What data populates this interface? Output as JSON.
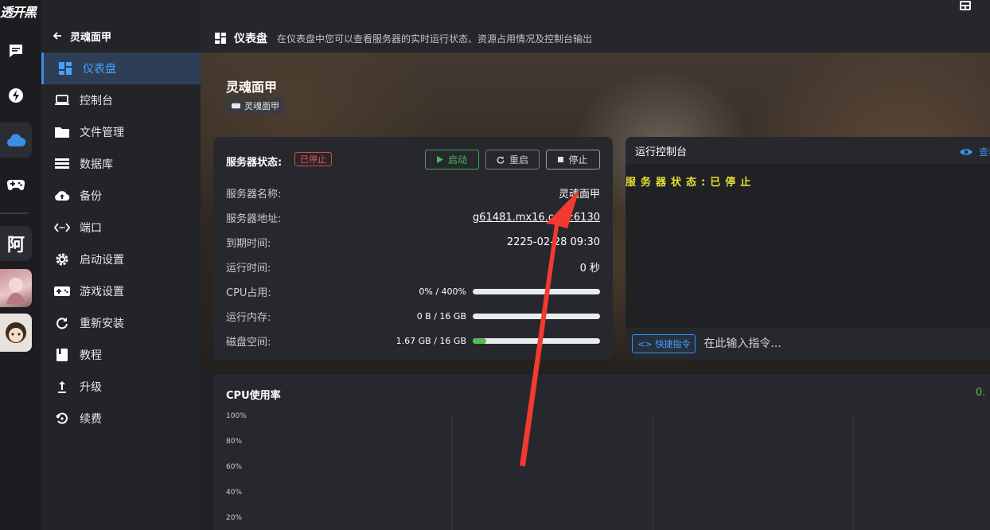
{
  "rail": {
    "logo_text": "透开黑",
    "avatar_letter": "阿"
  },
  "sidebar": {
    "back_label": "灵魂面甲",
    "items": [
      {
        "label": "仪表盘",
        "icon": "dashboard-icon"
      },
      {
        "label": "控制台",
        "icon": "console-icon"
      },
      {
        "label": "文件管理",
        "icon": "folder-icon"
      },
      {
        "label": "数据库",
        "icon": "database-icon"
      },
      {
        "label": "备份",
        "icon": "cloud-upload-icon"
      },
      {
        "label": "端口",
        "icon": "port-icon"
      },
      {
        "label": "启动设置",
        "icon": "gear-icon"
      },
      {
        "label": "游戏设置",
        "icon": "gamepad-icon"
      },
      {
        "label": "重新安装",
        "icon": "refresh-icon"
      },
      {
        "label": "教程",
        "icon": "book-icon"
      },
      {
        "label": "升级",
        "icon": "upgrade-icon"
      },
      {
        "label": "续费",
        "icon": "renew-icon"
      }
    ]
  },
  "header": {
    "title": "仪表盘",
    "description": "在仪表盘中您可以查看服务器的实时运行状态、资源占用情况及控制台输出"
  },
  "server": {
    "name": "灵魂面甲",
    "game_tag": "灵魂面甲"
  },
  "status": {
    "label": "服务器状态:",
    "badge": "已停止",
    "badge_color": "#e05252",
    "buttons": {
      "start": "启动",
      "restart": "重启",
      "stop": "停止"
    },
    "rows": {
      "name_key": "服务器名称:",
      "name_val": "灵魂面甲",
      "addr_key": "服务器地址:",
      "addr_val": "g61481.mx16.com:6130",
      "expire_key": "到期时间:",
      "expire_val": "2225-02-28 09:30",
      "uptime_key": "运行时间:",
      "uptime_val": "0 秒"
    },
    "meters": [
      {
        "key": "CPU占用:",
        "value": "0% / 400%",
        "fraction": 0
      },
      {
        "key": "运行内存:",
        "value": "0 B / 16 GB",
        "fraction": 0
      },
      {
        "key": "磁盘空间:",
        "value": "1.67 GB / 16 GB",
        "fraction": 0.104
      }
    ]
  },
  "console": {
    "title": "运行控制台",
    "view_label": "查看",
    "output_line": "服务器状态:已停止",
    "quick_label": "快捷指令",
    "input_placeholder": "在此输入指令..."
  },
  "cpu_usage": {
    "title": "CPU使用率",
    "current": "0."
  },
  "chart_data": {
    "type": "line",
    "title": "CPU使用率",
    "y_ticks": [
      "100%",
      "80%",
      "60%",
      "40%",
      "20%"
    ],
    "ylim": [
      0,
      100
    ],
    "series": [],
    "grid": true
  },
  "colors": {
    "accent": "#3b8fe6",
    "success": "#5cb85c",
    "danger": "#e05252",
    "console_text": "#e5e035"
  }
}
